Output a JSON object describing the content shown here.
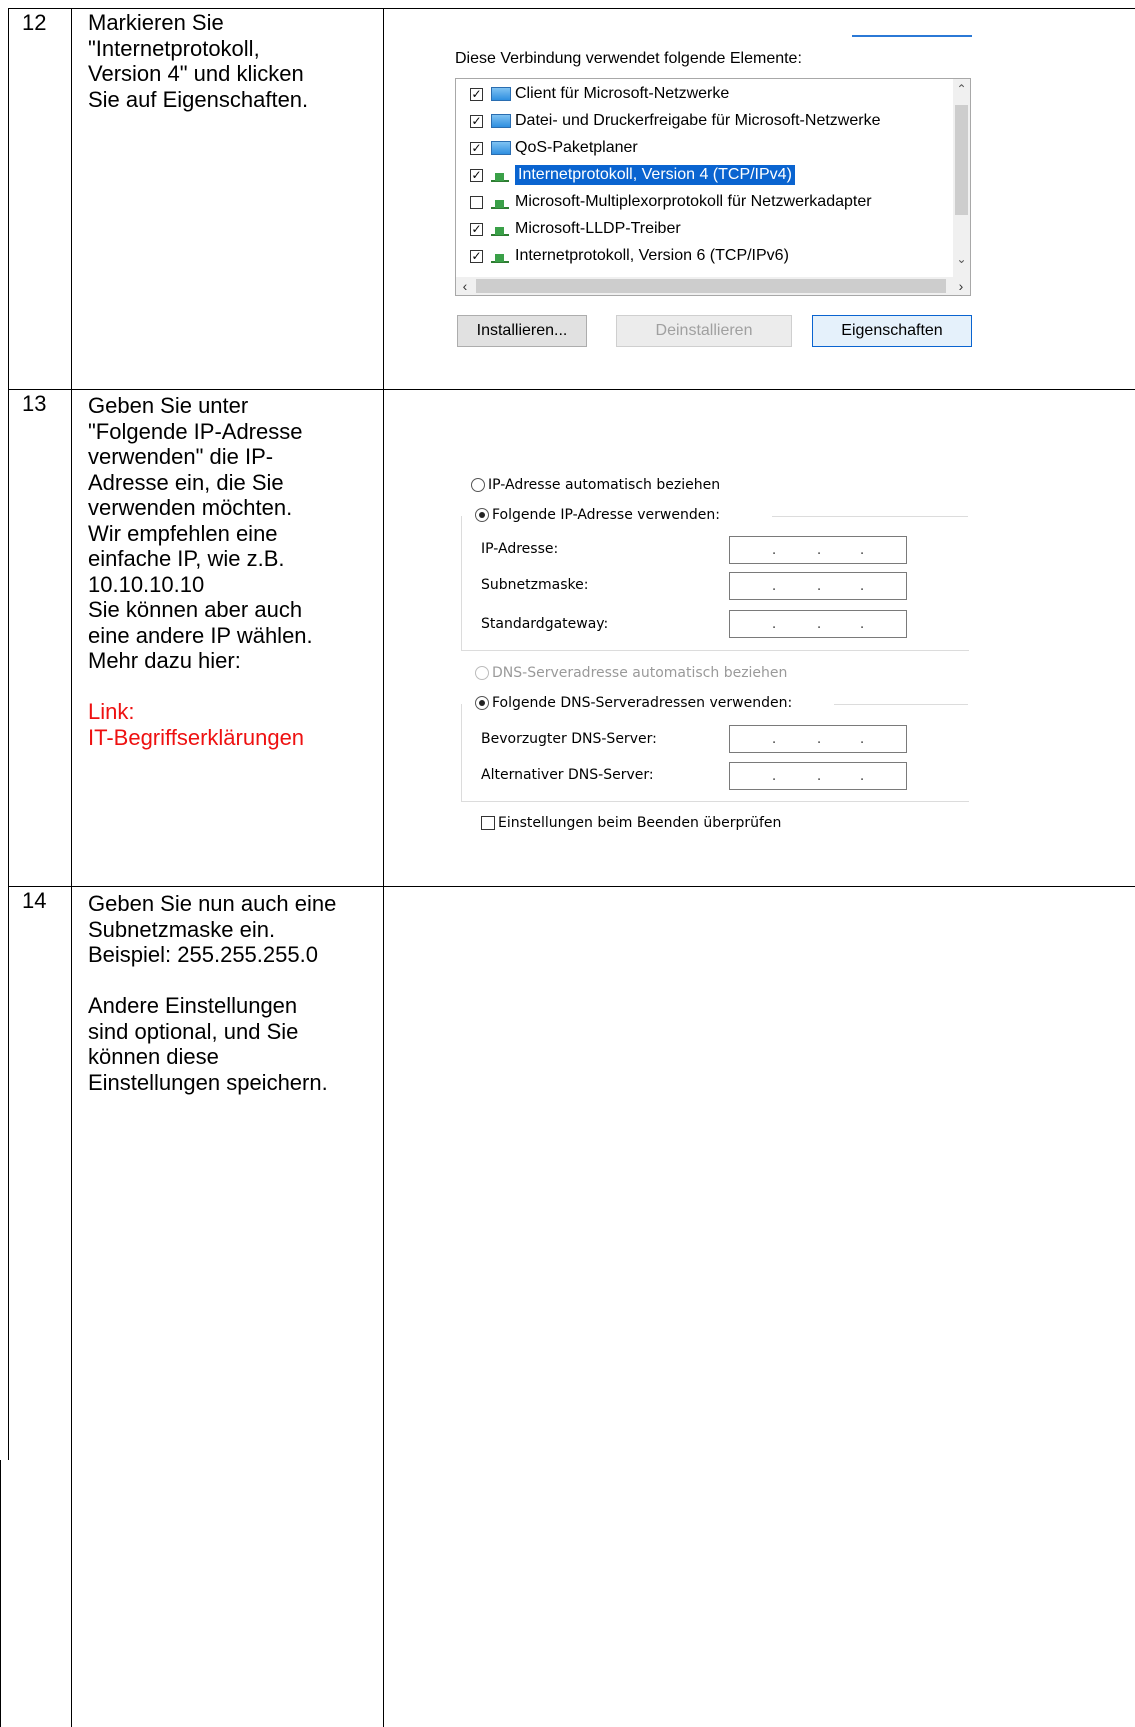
{
  "rows": [
    {
      "number": "12",
      "instruction": [
        "Markieren Sie",
        "\"Internetprotokoll,",
        "Version 4\" und klicken",
        "Sie auf Eigenschaften."
      ]
    },
    {
      "number": "13",
      "instruction": [
        "Geben Sie unter",
        "\"Folgende IP-Adresse",
        "verwenden\" die IP-",
        "Adresse ein, die Sie",
        "verwenden möchten.",
        "Wir empfehlen eine",
        "einfache IP, wie z.B.",
        "10.10.10.10",
        "Sie können aber auch",
        "eine andere IP wählen.",
        "Mehr dazu hier:"
      ],
      "link": [
        "Link:",
        "IT-Begriffserklärungen"
      ],
      "link_color": "#ee1111"
    },
    {
      "number": "14",
      "instruction_a": [
        "Geben Sie nun auch eine",
        "Subnetzmaske ein.",
        "Beispiel: 255.255.255.0"
      ],
      "instruction_b": [
        "Andere Einstellungen",
        "sind optional, und Sie",
        "können diese",
        "Einstellungen speichern."
      ]
    }
  ],
  "adapter_dialog": {
    "caption": "Diese Verbindung verwendet folgende Elemente:",
    "items": [
      {
        "label": "Client für Microsoft-Netzwerke",
        "checked": true,
        "icon": "network-client-icon",
        "selected": false
      },
      {
        "label": "Datei- und Druckerfreigabe für Microsoft-Netzwerke",
        "checked": true,
        "icon": "network-client-icon",
        "selected": false
      },
      {
        "label": "QoS-Paketplaner",
        "checked": true,
        "icon": "network-client-icon",
        "selected": false
      },
      {
        "label": "Internetprotokoll, Version 4 (TCP/IPv4)",
        "checked": true,
        "icon": "protocol-icon",
        "selected": true
      },
      {
        "label": "Microsoft-Multiplexorprotokoll für Netzwerkadapter",
        "checked": false,
        "icon": "protocol-icon",
        "selected": false
      },
      {
        "label": "Microsoft-LLDP-Treiber",
        "checked": true,
        "icon": "protocol-icon",
        "selected": false
      },
      {
        "label": "Internetprotokoll, Version 6 (TCP/IPv6)",
        "checked": true,
        "icon": "protocol-icon",
        "selected": false
      }
    ],
    "buttons": {
      "install": "Installieren...",
      "uninstall": "Deinstallieren",
      "properties": "Eigenschaften"
    },
    "selection_color": "#0a64d0"
  },
  "ipv4_dialog": {
    "ip_auto": "IP-Adresse automatisch beziehen",
    "ip_manual": "Folgende IP-Adresse verwenden:",
    "ip_address_label": "IP-Adresse:",
    "subnet_label": "Subnetzmaske:",
    "gateway_label": "Standardgateway:",
    "dns_auto": "DNS-Serveradresse automatisch beziehen",
    "dns_manual": "Folgende DNS-Serveradressen verwenden:",
    "dns_preferred_label": "Bevorzugter DNS-Server:",
    "dns_alternate_label": "Alternativer DNS-Server:",
    "validate_on_exit": "Einstellungen beim Beenden überprüfen",
    "ip_dot": "."
  }
}
